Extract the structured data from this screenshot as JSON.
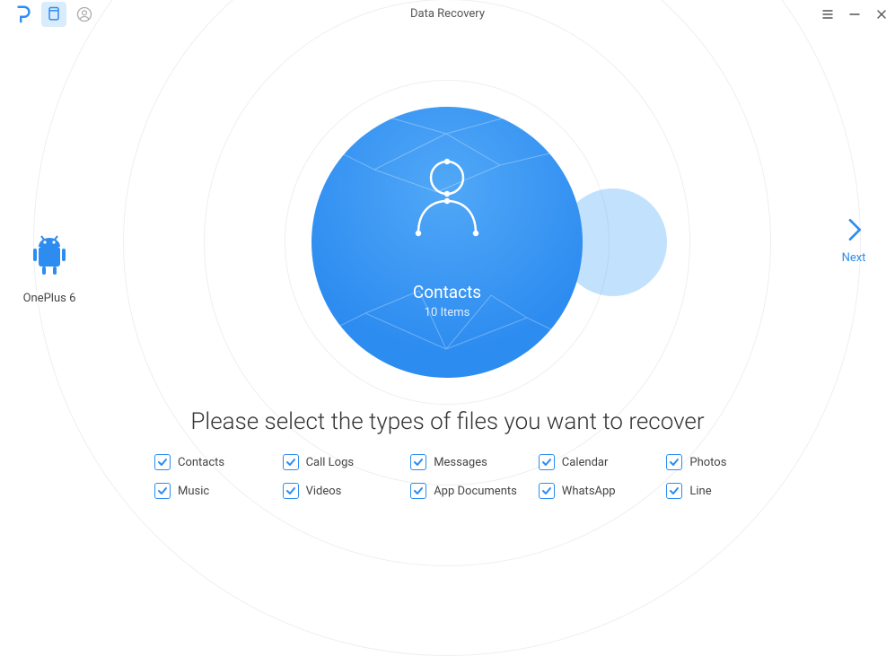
{
  "window": {
    "title": "Data Recovery"
  },
  "device": {
    "label": "OnePlus 6"
  },
  "next": {
    "label": "Next"
  },
  "featured": {
    "title": "Contacts",
    "subtitle": "10 Items"
  },
  "prompt": "Please select the types of files you want to recover",
  "options": [
    {
      "label": "Contacts",
      "checked": true
    },
    {
      "label": "Call Logs",
      "checked": true
    },
    {
      "label": "Messages",
      "checked": true
    },
    {
      "label": "Calendar",
      "checked": true
    },
    {
      "label": "Photos",
      "checked": true
    },
    {
      "label": "Music",
      "checked": true
    },
    {
      "label": "Videos",
      "checked": true
    },
    {
      "label": "App Documents",
      "checked": true
    },
    {
      "label": "WhatsApp",
      "checked": true
    },
    {
      "label": "Line",
      "checked": true
    }
  ]
}
